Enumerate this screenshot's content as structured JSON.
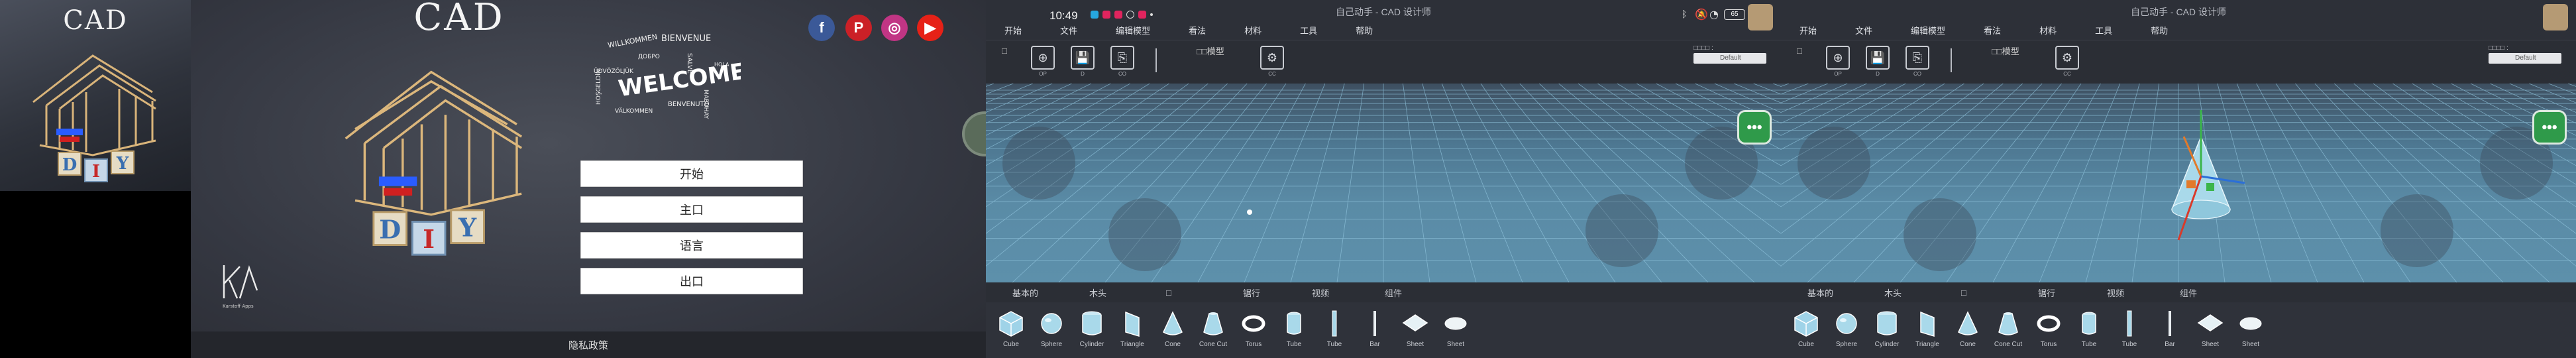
{
  "panel1": {
    "app_title": "CAD"
  },
  "panel2": {
    "app_title": "CAD",
    "menu": [
      "开始",
      "主口",
      "语言",
      "出口"
    ],
    "privacy": "隐私政策",
    "social": [
      {
        "name": "facebook-icon",
        "glyph": "f",
        "color": "#3b5998"
      },
      {
        "name": "pinterest-icon",
        "glyph": "P",
        "color": "#cb2027"
      },
      {
        "name": "instagram-icon",
        "glyph": "◎",
        "color": "#c13584"
      },
      {
        "name": "youtube-icon",
        "glyph": "▶",
        "color": "#e62117"
      }
    ],
    "wordcloud_center": "WELCOME"
  },
  "editor1": {
    "time": "10:49",
    "battery": "65",
    "title": "自己动手 - CAD 设计师",
    "menu": [
      "文件",
      "编辑模型",
      "看法",
      "材料",
      "工具",
      "帮助"
    ],
    "start_label": "开始",
    "toolbar": {
      "checkbox_label": "□",
      "model_label": "□□模型",
      "project_label": "□□□□ :",
      "project_value": "Default"
    },
    "tabs": [
      "基本的",
      "木头",
      "□",
      "锯行",
      "视频",
      "组件"
    ],
    "shapes": [
      "Cube",
      "Sphere",
      "Cylinder",
      "Triangle",
      "Cone",
      "Cone Cut",
      "Torus",
      "Tube",
      "Tube",
      "Bar",
      "Sheet",
      "Sheet"
    ],
    "fab": "•••"
  },
  "editor2": {
    "title": "自己动手 - CAD 设计师",
    "menu": [
      "开始",
      "文件",
      "编辑模型",
      "看法",
      "材料",
      "工具",
      "帮助"
    ],
    "toolbar": {
      "checkbox_label": "□",
      "model_label": "□□模型",
      "project_label": "□□□□ :",
      "project_value": "Default"
    },
    "tabs": [
      "基本的",
      "木头",
      "□",
      "锯行",
      "视频",
      "组件"
    ],
    "shapes": [
      "Cube",
      "Sphere",
      "Cylinder",
      "Triangle",
      "Cone",
      "Cone Cut",
      "Torus",
      "Tube",
      "Tube",
      "Bar",
      "Sheet",
      "Sheet"
    ],
    "fab": "•••"
  }
}
